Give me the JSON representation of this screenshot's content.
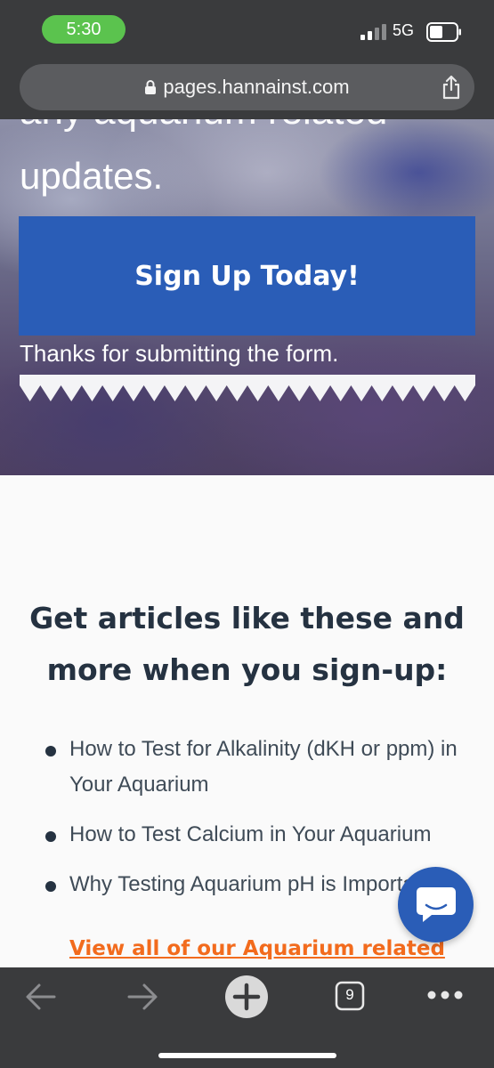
{
  "status_bar": {
    "time": "5:30",
    "network": "5G",
    "time_pill_color": "#5bc34e"
  },
  "url_bar": {
    "url": "pages.hannainst.com"
  },
  "hero": {
    "partial_line": "any aquarium related",
    "updates_line": "updates.",
    "signup_button": "Sign Up Today!",
    "thanks_message": "Thanks for submitting the form."
  },
  "content": {
    "headline": "Get articles like these and more when you sign-up:",
    "articles": [
      "How to Test for Alkalinity (dKH or ppm) in Your Aquarium",
      "How to Test Calcium in Your Aquarium",
      "Why Testing Aquarium pH is Important"
    ],
    "view_all_link": "View all of our Aquarium related"
  },
  "toolbar": {
    "tab_count": "9"
  },
  "colors": {
    "brand_blue": "#2a5db7",
    "link_orange": "#f26b1d",
    "heading": "#253241",
    "chrome": "#3a3b3d"
  },
  "icons": [
    "lock-icon",
    "share-icon",
    "signal-icon",
    "battery-icon",
    "chat-icon",
    "back-arrow-icon",
    "forward-arrow-icon",
    "new-tab-icon",
    "tabs-icon",
    "more-icon"
  ]
}
